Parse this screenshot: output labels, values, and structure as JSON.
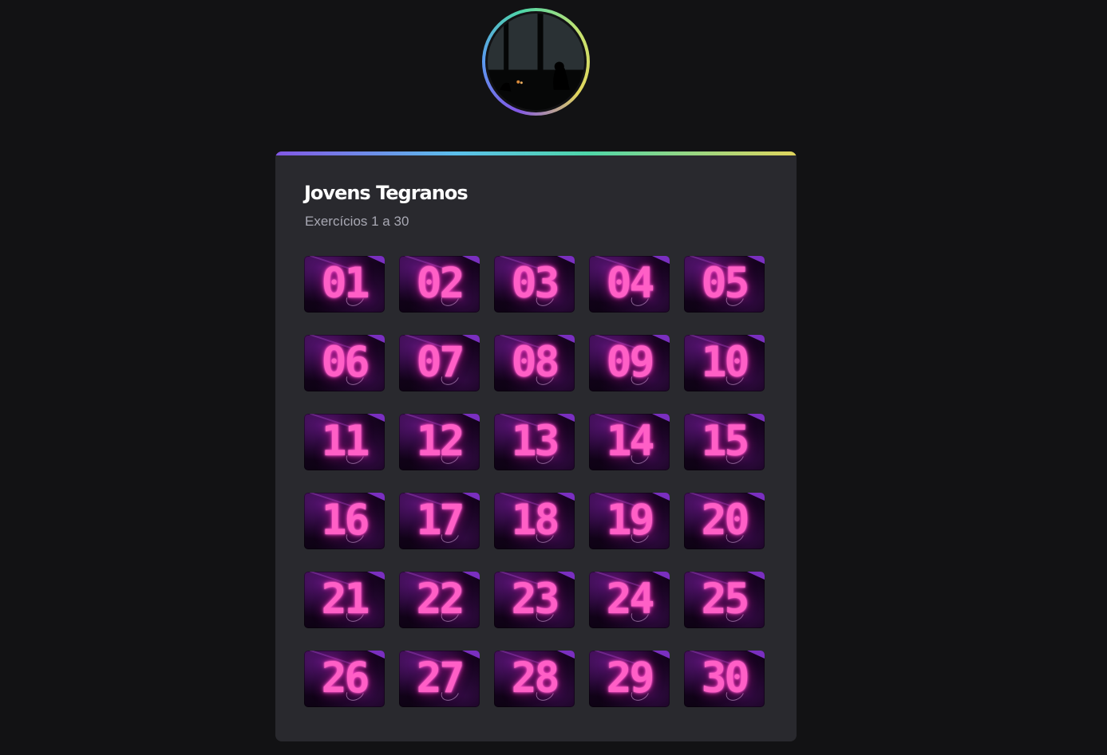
{
  "profile": {
    "avatar_alt": "Profile photo"
  },
  "card": {
    "title": "Jovens Tegranos",
    "subtitle": "Exercícios 1 a 30"
  },
  "exercises": [
    "01",
    "02",
    "03",
    "04",
    "05",
    "06",
    "07",
    "08",
    "09",
    "10",
    "11",
    "12",
    "13",
    "14",
    "15",
    "16",
    "17",
    "18",
    "19",
    "20",
    "21",
    "22",
    "23",
    "24",
    "25",
    "26",
    "27",
    "28",
    "29",
    "30"
  ],
  "colors": {
    "background": "#121214",
    "card": "#29292e",
    "neon_pink": "#ff5fc6",
    "gradient": [
      "#8257e5",
      "#5bc0eb",
      "#4ed6a8",
      "#e1d55d"
    ]
  }
}
